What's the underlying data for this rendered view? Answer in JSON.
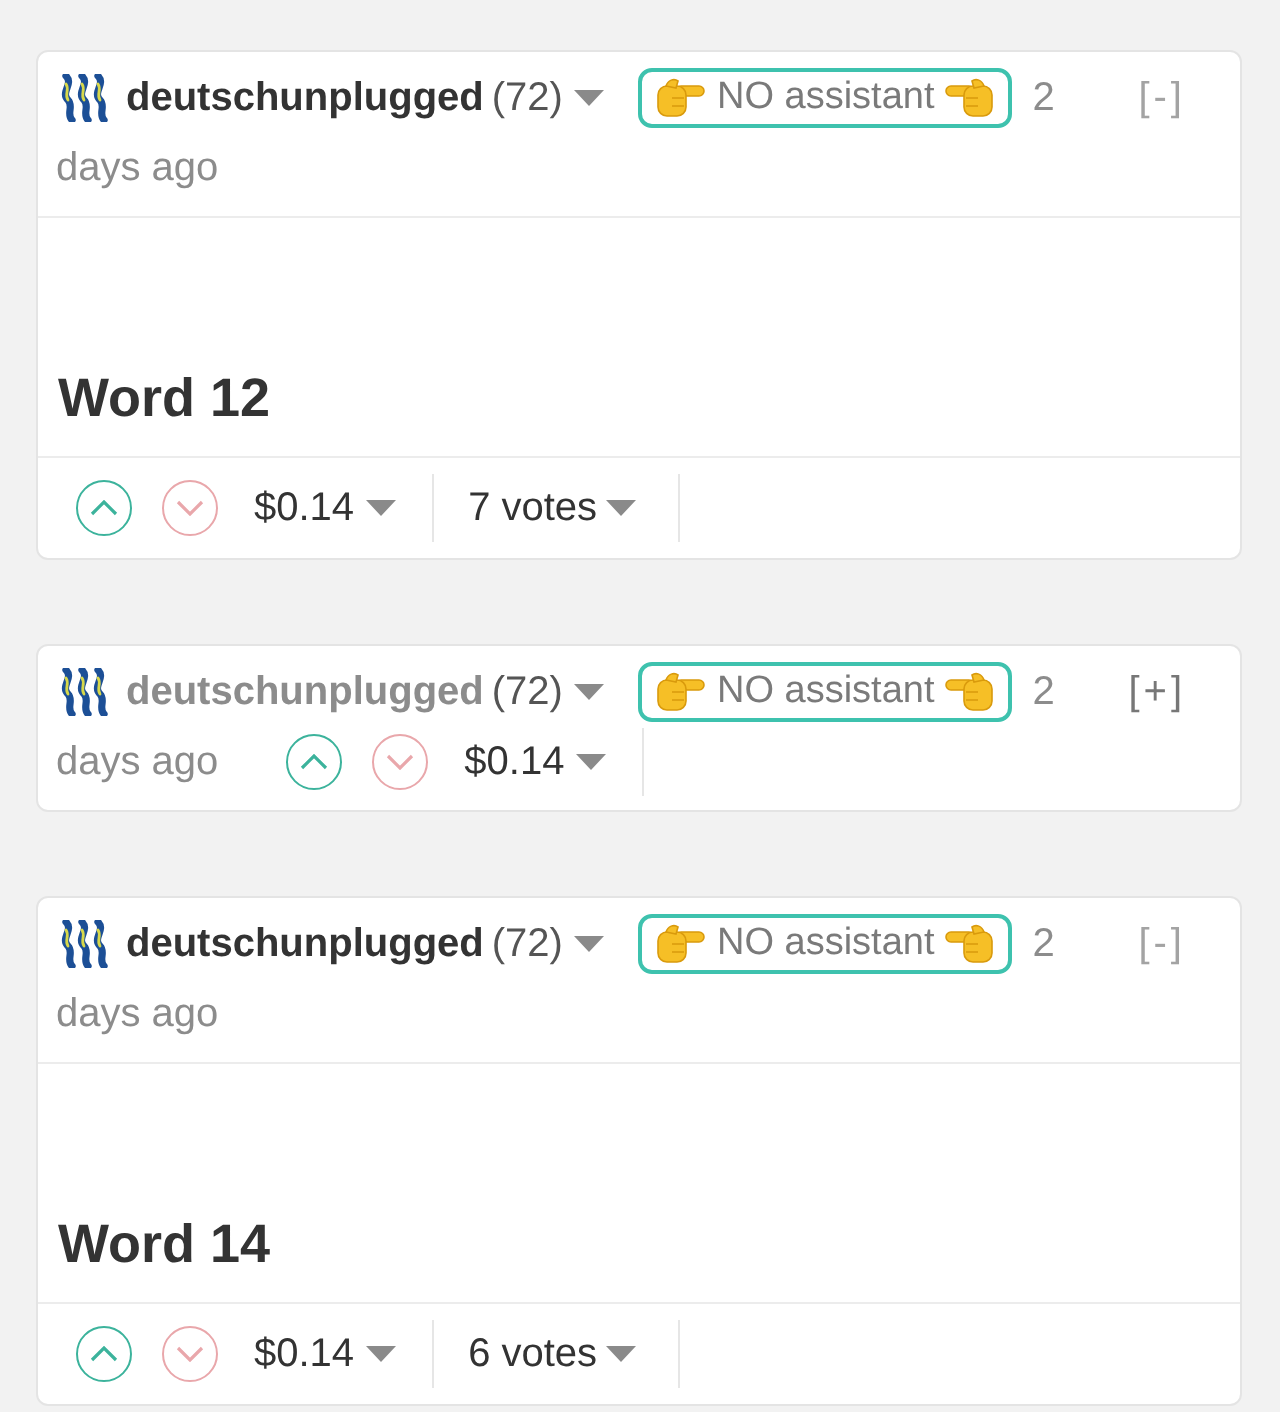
{
  "comments": [
    {
      "author": "deutschunplugged",
      "reputation": "(72)",
      "tag": "NO assistant",
      "time": "2 days ago",
      "toggle": "[-]",
      "collapsed": false,
      "title": "Word 12",
      "payout": "$0.14",
      "votes": "7 votes"
    },
    {
      "author": "deutschunplugged",
      "reputation": "(72)",
      "tag": "NO assistant",
      "time": "2 days ago",
      "toggle": "[+]",
      "collapsed": true,
      "payout": "$0.14"
    },
    {
      "author": "deutschunplugged",
      "reputation": "(72)",
      "tag": "NO assistant",
      "time": "2 days ago",
      "toggle": "[-]",
      "collapsed": false,
      "title": "Word 14",
      "payout": "$0.14",
      "votes": "6 votes"
    }
  ]
}
